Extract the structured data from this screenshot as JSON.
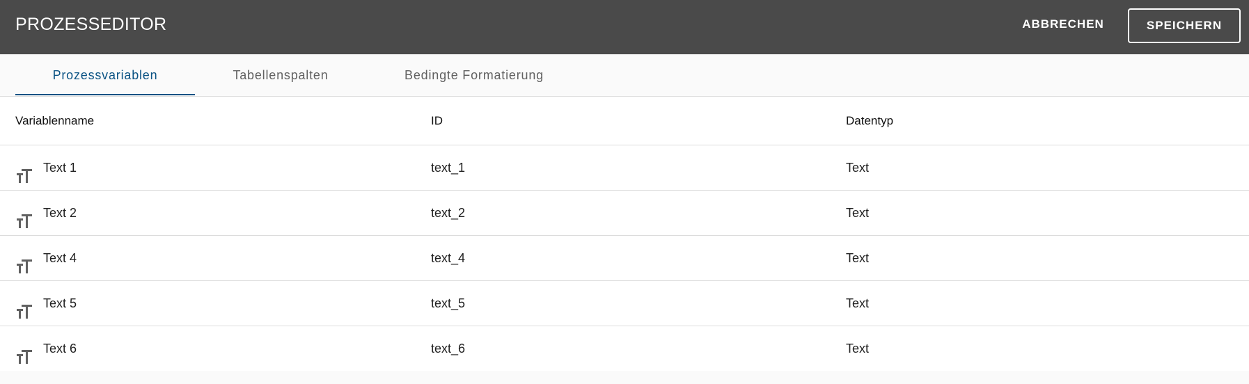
{
  "header": {
    "title": "PROZESSEDITOR",
    "cancel_label": "ABBRECHEN",
    "save_label": "SPEICHERN"
  },
  "tabs": [
    {
      "label": "Prozessvariablen",
      "active": true
    },
    {
      "label": "Tabellenspalten",
      "active": false
    },
    {
      "label": "Bedingte Formatierung",
      "active": false
    }
  ],
  "table": {
    "columns": [
      "Variablenname",
      "ID",
      "Datentyp"
    ],
    "rows": [
      {
        "icon": "text-format-icon",
        "name": "Text 1",
        "id": "text_1",
        "type": "Text"
      },
      {
        "icon": "text-format-icon",
        "name": "Text 2",
        "id": "text_2",
        "type": "Text"
      },
      {
        "icon": "text-format-icon",
        "name": "Text 4",
        "id": "text_4",
        "type": "Text"
      },
      {
        "icon": "text-format-icon",
        "name": "Text 5",
        "id": "text_5",
        "type": "Text"
      },
      {
        "icon": "text-format-icon",
        "name": "Text 6",
        "id": "text_6",
        "type": "Text"
      }
    ]
  },
  "colors": {
    "header_bg": "#4a4a4a",
    "accent": "#0b5384",
    "icon": "#616161"
  }
}
